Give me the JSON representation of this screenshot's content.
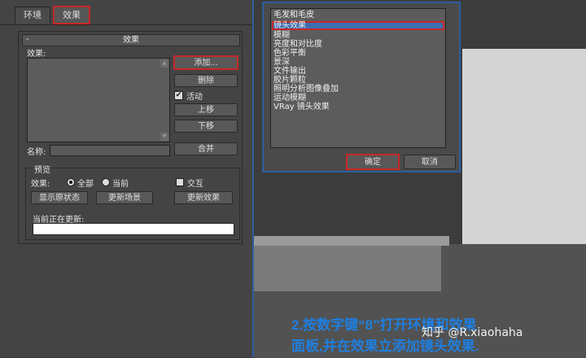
{
  "tabs": [
    "环境",
    "效果"
  ],
  "rollout": {
    "minus": "-",
    "title": "效果",
    "effects_label": "效果:",
    "add_button": "添加...",
    "delete_button": "删除",
    "active_label": "活动",
    "active_checked": "✔",
    "up_button": "上移",
    "down_button": "下移",
    "name_label": "名称:",
    "merge_button": "合并"
  },
  "preview": {
    "group_label": "预览",
    "effects_label": "效果:",
    "all_label": "全部",
    "current_label": "当前",
    "interactive_label": "交互",
    "show_original_button": "显示原状态",
    "update_scene_button": "更新场景",
    "update_effect_button": "更新效果",
    "updating_label": "当前正在更新:"
  },
  "dialog": {
    "items": [
      "毛发和毛皮",
      "镜头效果",
      "模糊",
      "亮度和对比度",
      "色彩平衡",
      "景深",
      "文件输出",
      "胶片颗粒",
      "照明分析图像叠加",
      "运动模糊",
      "VRay 镜头效果"
    ],
    "selected_index": 1,
    "ok_button": "确定",
    "cancel_button": "取消"
  },
  "captions": {
    "line1": "2.按数字键“8”打开环境和效果",
    "line2": "面板,并在效果立添加镜头效果."
  },
  "watermark": "知乎 @R.xiaohaha",
  "colors": {
    "highlight": "#c62828",
    "selection": "#3b6fb0",
    "caption": "#1f7fe0",
    "panel": "#444444"
  }
}
